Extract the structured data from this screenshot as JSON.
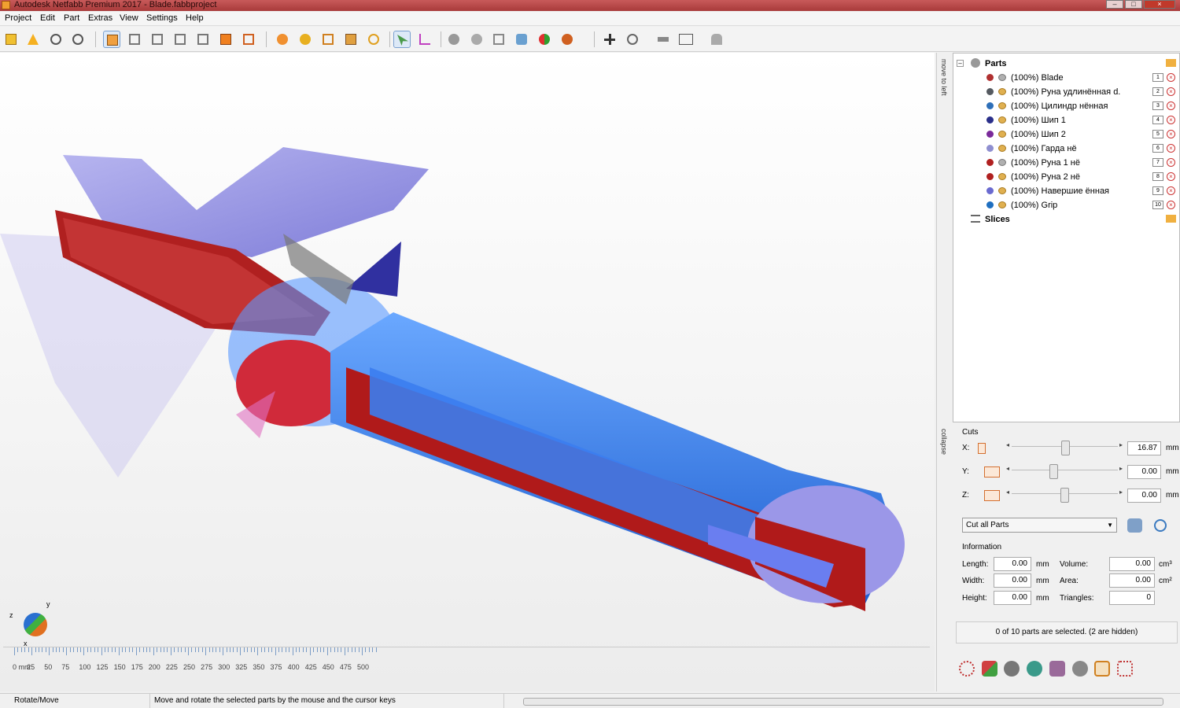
{
  "window": {
    "title": "Autodesk Netfabb Premium 2017 - Blade.fabbproject"
  },
  "menu": [
    "Project",
    "Edit",
    "Part",
    "Extras",
    "View",
    "Settings",
    "Help"
  ],
  "side_tabs": {
    "move_to_left": "move to left",
    "collapse": "collapse"
  },
  "tree": {
    "root": "Parts",
    "parts": [
      {
        "label": "(100%) Blade",
        "color": "#b03030",
        "eye_hidden": true,
        "num": "1"
      },
      {
        "label": "(100%) Руна удлинённая   d.",
        "color": "#555a60",
        "eye_hidden": false,
        "num": "2"
      },
      {
        "label": "(100%) Цилиндр   нённая",
        "color": "#2e6fb8",
        "eye_hidden": false,
        "num": "3"
      },
      {
        "label": "(100%) Шип 1",
        "color": "#2a2f8a",
        "eye_hidden": false,
        "num": "4"
      },
      {
        "label": "(100%) Шип 2",
        "color": "#7a2a9a",
        "eye_hidden": false,
        "num": "5"
      },
      {
        "label": "(100%) Гарда      нё",
        "color": "#8f8fd0",
        "eye_hidden": false,
        "num": "6"
      },
      {
        "label": "(100%) Руна 1     нё",
        "color": "#b02020",
        "eye_hidden": true,
        "num": "7"
      },
      {
        "label": "(100%) Руна 2     нё",
        "color": "#b02020",
        "eye_hidden": false,
        "num": "8"
      },
      {
        "label": "(100%) Навершие   ённая",
        "color": "#6a6ad0",
        "eye_hidden": false,
        "num": "9"
      },
      {
        "label": "(100%) Grip",
        "color": "#1f6fc0",
        "eye_hidden": false,
        "num": "10"
      }
    ],
    "slices": "Slices"
  },
  "cuts": {
    "title": "Cuts",
    "x": {
      "label": "X:",
      "value": "16.87",
      "unit": "mm",
      "pos": 0.51
    },
    "y": {
      "label": "Y:",
      "value": "0.00",
      "unit": "mm",
      "pos": 0.39
    },
    "z": {
      "label": "Z:",
      "value": "0.00",
      "unit": "mm",
      "pos": 0.5
    },
    "mode": "Cut all Parts"
  },
  "information": {
    "title": "Information",
    "length": {
      "label": "Length:",
      "value": "0.00",
      "unit": "mm"
    },
    "width": {
      "label": "Width:",
      "value": "0.00",
      "unit": "mm"
    },
    "height": {
      "label": "Height:",
      "value": "0.00",
      "unit": "mm"
    },
    "volume": {
      "label": "Volume:",
      "value": "0.00",
      "unit": "cm³"
    },
    "area": {
      "label": "Area:",
      "value": "0.00",
      "unit": "cm²"
    },
    "triangles": {
      "label": "Triangles:",
      "value": "0"
    }
  },
  "selection_status": "0 of 10 parts are selected. (2 are hidden)",
  "ruler": {
    "labels": [
      "0 mm",
      "25",
      "50",
      "75",
      "100",
      "125",
      "150",
      "175",
      "200",
      "225",
      "250",
      "275",
      "300",
      "325",
      "350",
      "375",
      "400",
      "425",
      "450",
      "475",
      "500"
    ]
  },
  "status": {
    "mode": "Rotate/Move",
    "hint": "Move and rotate the selected parts by the mouse and the cursor keys"
  },
  "axes": {
    "x": "x",
    "y": "y",
    "z": "z"
  }
}
